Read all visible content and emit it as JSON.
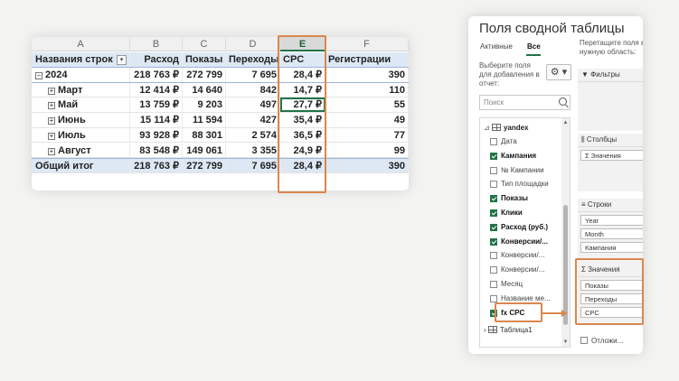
{
  "colors": {
    "accent": "#217346",
    "highlight": "#d9874e",
    "header_band": "#dde8f4"
  },
  "sheet": {
    "columns": [
      "A",
      "B",
      "C",
      "D",
      "E",
      "F"
    ],
    "selected_column": "E",
    "header": [
      "Названия строк",
      "Расход",
      "Показы",
      "Переходы",
      "CPC",
      "Регистрации"
    ],
    "rows": [
      {
        "type": "year",
        "label": "2024",
        "expand": "−",
        "values": [
          "218 763 ₽",
          "272 799",
          "7 695",
          "28,4 ₽",
          "390"
        ]
      },
      {
        "type": "month",
        "label": "Март",
        "expand": "+",
        "values": [
          "12 414 ₽",
          "14 640",
          "842",
          "14,7 ₽",
          "110"
        ]
      },
      {
        "type": "month",
        "label": "Май",
        "expand": "+",
        "values": [
          "13 759 ₽",
          "9 203",
          "497",
          "27,7 ₽",
          "55"
        ]
      },
      {
        "type": "month",
        "label": "Июнь",
        "expand": "+",
        "values": [
          "15 114 ₽",
          "11 594",
          "427",
          "35,4 ₽",
          "49"
        ]
      },
      {
        "type": "month",
        "label": "Июль",
        "expand": "+",
        "values": [
          "93 928 ₽",
          "88 301",
          "2 574",
          "36,5 ₽",
          "77"
        ]
      },
      {
        "type": "month",
        "label": "Август",
        "expand": "+",
        "values": [
          "83 548 ₽",
          "149 061",
          "3 355",
          "24,9 ₽",
          "99"
        ]
      }
    ],
    "total": {
      "label": "Общий итог",
      "values": [
        "218 763 ₽",
        "272 799",
        "7 695",
        "28,4 ₽",
        "390"
      ]
    },
    "dropdown_glyph": "▾"
  },
  "pane": {
    "title": "Поля сводной таблицы",
    "tabs": [
      "Активные",
      "Все"
    ],
    "active_tab": "Все",
    "choose_text": [
      "Выберите поля",
      "для добавления в",
      "отчет:"
    ],
    "drag_text": [
      "Перетащите поля в",
      "нужную область:"
    ],
    "gear_glyph": "⚙ ▾",
    "search_placeholder": "Поиск",
    "tree_root": "yandex",
    "fields": [
      {
        "label": "Дата",
        "checked": false
      },
      {
        "label": "Кампания",
        "checked": true
      },
      {
        "label": "№ Кампании",
        "checked": false
      },
      {
        "label": "Тип площадки",
        "checked": false
      },
      {
        "label": "Показы",
        "checked": true
      },
      {
        "label": "Клики",
        "checked": true
      },
      {
        "label": "Расход (руб.)",
        "checked": true
      },
      {
        "label": "Конверсии/...",
        "checked": true
      },
      {
        "label": "Конверсии/...",
        "checked": false
      },
      {
        "label": "Конверсии/...",
        "checked": false
      },
      {
        "label": "Месяц",
        "checked": false
      },
      {
        "label": "Название ме...",
        "checked": false
      },
      {
        "label": "fx CPC",
        "checked": true
      }
    ],
    "table_node": "Таблица1",
    "areas": {
      "filters": {
        "label": "▼ Фильтры",
        "items": []
      },
      "columns": {
        "label": "⫼ Столбцы",
        "items": [
          "Σ Значения"
        ]
      },
      "rows": {
        "label": "≡ Строки",
        "items": [
          "Year",
          "Month",
          "Кампания"
        ]
      },
      "values": {
        "label": "Σ Значения",
        "items": [
          "Показы",
          "Переходы",
          "CPC"
        ]
      }
    },
    "defer_label": "Отложи..."
  }
}
